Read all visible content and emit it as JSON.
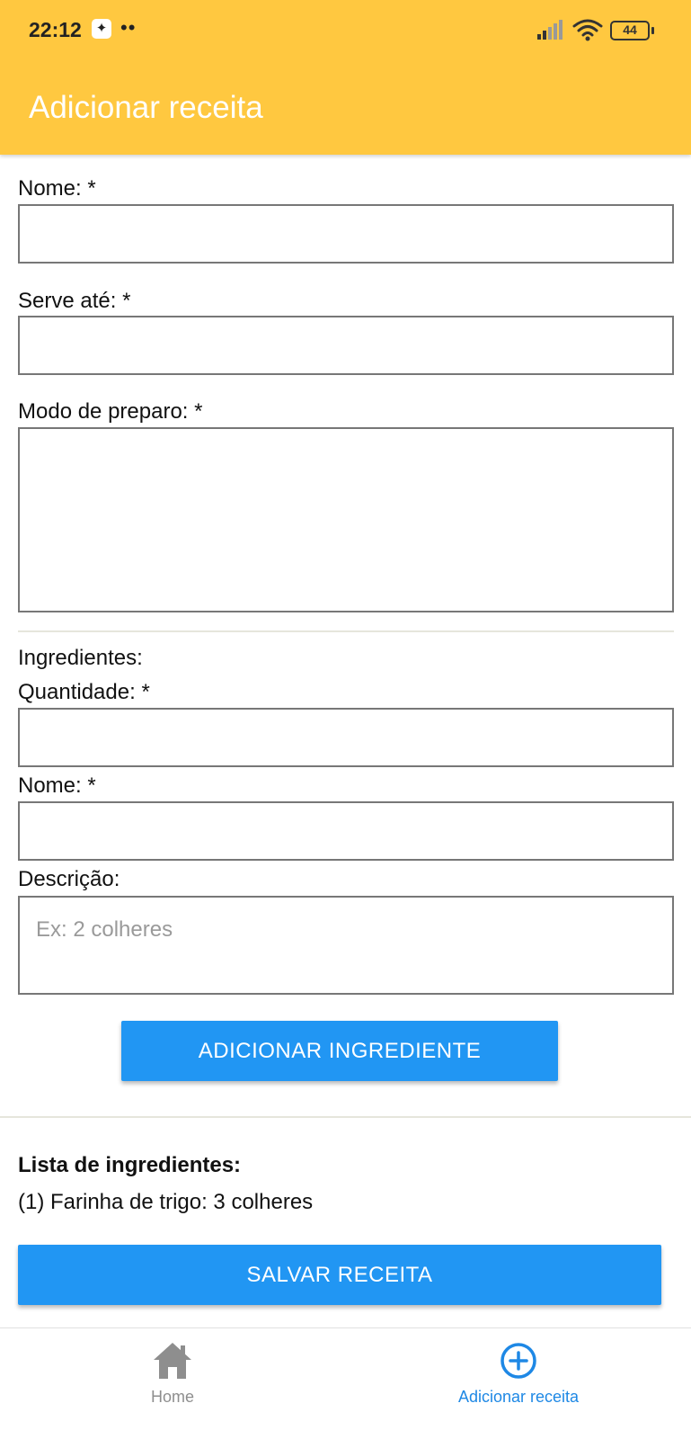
{
  "status_bar": {
    "time": "22:12",
    "notification_icon": "app-notification-icon",
    "dots": "••",
    "battery": "44"
  },
  "header": {
    "title": "Adicionar receita"
  },
  "form": {
    "name_label": "Nome: *",
    "name_value": "",
    "serves_label": "Serve até: *",
    "serves_value": "",
    "method_label": "Modo de preparo: *",
    "method_value": ""
  },
  "ingredients": {
    "section_label": "Ingredientes:",
    "quantity_label": "Quantidade: *",
    "quantity_value": "",
    "name_label": "Nome: *",
    "name_value": "",
    "description_label": "Descrição:",
    "description_value": "",
    "description_placeholder": "Ex: 2 colheres",
    "add_button": "ADICIONAR INGREDIENTE"
  },
  "ingredient_list": {
    "title": "Lista de ingredientes:",
    "items": [
      "(1) Farinha de trigo: 3 colheres"
    ]
  },
  "save_button": "SALVAR RECEITA",
  "tabs": [
    {
      "label": "Home",
      "icon": "home-icon",
      "active": false
    },
    {
      "label": "Adicionar receita",
      "icon": "add-circle-icon",
      "active": true
    }
  ],
  "colors": {
    "header": "#FFC840",
    "primary_button": "#2196F3",
    "active_tab": "#1E88E5",
    "inactive_tab": "#8E8E8E"
  }
}
